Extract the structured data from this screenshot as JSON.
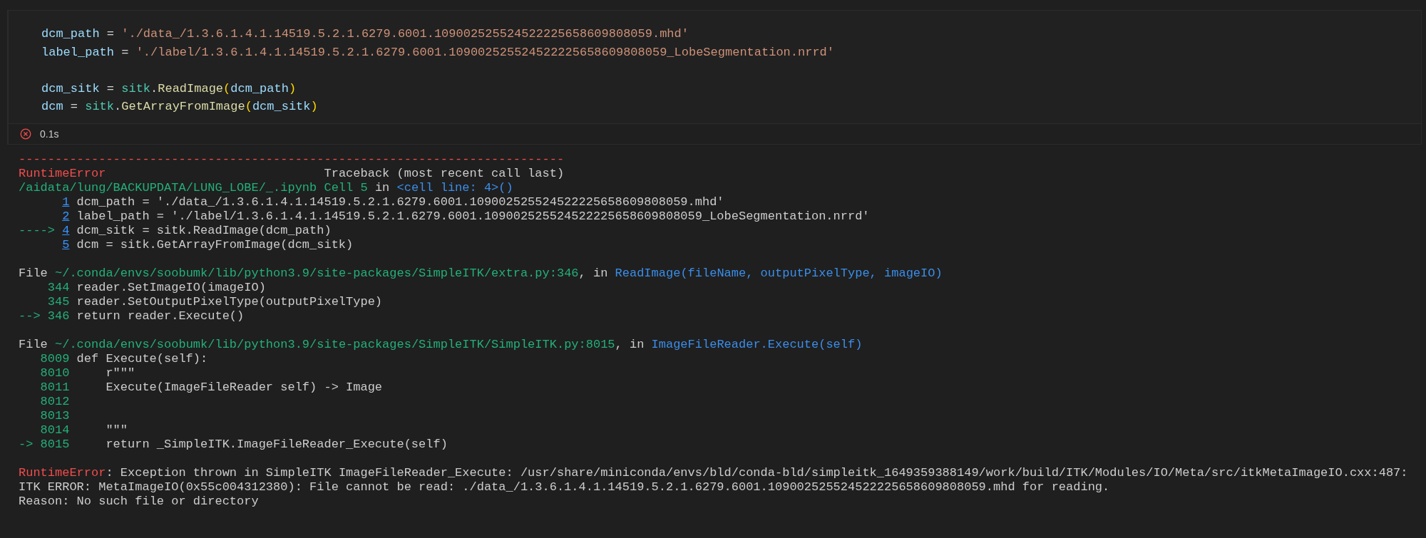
{
  "cell": {
    "code_blocks": [
      [
        [
          {
            "kind": "var",
            "text": "dcm_path"
          },
          {
            "kind": "op",
            "text": " = "
          },
          {
            "kind": "str",
            "text": "'./data_/1.3.6.1.4.1.14519.5.2.1.6279.6001.109002525524522225658609808059.mhd'"
          }
        ],
        [
          {
            "kind": "var",
            "text": "label_path"
          },
          {
            "kind": "op",
            "text": " = "
          },
          {
            "kind": "str",
            "text": "'./label/1.3.6.1.4.1.14519.5.2.1.6279.6001.109002525524522225658609808059_LobeSegmentation.nrrd'"
          }
        ]
      ],
      [
        [
          {
            "kind": "var",
            "text": "dcm_sitk"
          },
          {
            "kind": "op",
            "text": " = "
          },
          {
            "kind": "module",
            "text": "sitk"
          },
          {
            "kind": "op",
            "text": "."
          },
          {
            "kind": "func",
            "text": "ReadImage"
          },
          {
            "kind": "paren",
            "text": "("
          },
          {
            "kind": "var",
            "text": "dcm_path"
          },
          {
            "kind": "paren",
            "text": ")"
          }
        ],
        [
          {
            "kind": "var",
            "text": "dcm"
          },
          {
            "kind": "op",
            "text": " = "
          },
          {
            "kind": "module",
            "text": "sitk"
          },
          {
            "kind": "op",
            "text": "."
          },
          {
            "kind": "func",
            "text": "GetArrayFromImage"
          },
          {
            "kind": "paren",
            "text": "("
          },
          {
            "kind": "var",
            "text": "dcm_sitk"
          },
          {
            "kind": "paren",
            "text": ")"
          }
        ]
      ]
    ],
    "status": {
      "failed": true,
      "duration": "0.1s"
    }
  },
  "output": {
    "blocks": [
      [
        {
          "kind": "text",
          "segments": [
            {
              "kind": "error",
              "text": "---------------------------------------------------------------------------"
            }
          ]
        },
        {
          "kind": "text",
          "segments": [
            {
              "kind": "error",
              "text": "RuntimeError"
            },
            {
              "kind": "plain",
              "text": "                              Traceback (most recent call last)"
            }
          ]
        },
        {
          "kind": "text",
          "segments": [
            {
              "kind": "path",
              "text": "/aidata/lung/BACKUPDATA/LUNG_LOBE/_.ipynb Cell 5"
            },
            {
              "kind": "plain",
              "text": " in "
            },
            {
              "kind": "call",
              "text": "<cell line: 4>()"
            }
          ]
        },
        {
          "kind": "frame",
          "number": "1",
          "linked": true,
          "code": "dcm_path = './data_/1.3.6.1.4.1.14519.5.2.1.6279.6001.109002525524522225658609808059.mhd'"
        },
        {
          "kind": "frame",
          "number": "2",
          "linked": true,
          "code": "label_path = './label/1.3.6.1.4.1.14519.5.2.1.6279.6001.109002525524522225658609808059_LobeSegmentation.nrrd'"
        },
        {
          "kind": "frame",
          "marker": "---->",
          "number": "4",
          "linked": true,
          "code": "dcm_sitk = sitk.ReadImage(dcm_path)"
        },
        {
          "kind": "frame",
          "number": "5",
          "linked": true,
          "code": "dcm = sitk.GetArrayFromImage(dcm_sitk)"
        }
      ],
      [
        {
          "kind": "text",
          "segments": [
            {
              "kind": "plain",
              "text": "File "
            },
            {
              "kind": "path",
              "text": "~/.conda/envs/soobumk/lib/python3.9/site-packages/SimpleITK/extra.py:346"
            },
            {
              "kind": "plain",
              "text": ", in "
            },
            {
              "kind": "call",
              "text": "ReadImage(fileName, outputPixelType, imageIO)"
            }
          ]
        },
        {
          "kind": "frame",
          "number": "344",
          "linked": false,
          "code": "reader.SetImageIO(imageIO)"
        },
        {
          "kind": "frame",
          "number": "345",
          "linked": false,
          "code": "reader.SetOutputPixelType(outputPixelType)"
        },
        {
          "kind": "frame",
          "marker": "-->",
          "number": "346",
          "linked": false,
          "code": "return reader.Execute()"
        }
      ],
      [
        {
          "kind": "text",
          "segments": [
            {
              "kind": "plain",
              "text": "File "
            },
            {
              "kind": "path",
              "text": "~/.conda/envs/soobumk/lib/python3.9/site-packages/SimpleITK/SimpleITK.py:8015"
            },
            {
              "kind": "plain",
              "text": ", in "
            },
            {
              "kind": "call",
              "text": "ImageFileReader.Execute(self)"
            }
          ]
        },
        {
          "kind": "frame",
          "number": "8009",
          "linked": false,
          "code": "def Execute(self):"
        },
        {
          "kind": "frame",
          "number": "8010",
          "linked": false,
          "code": "    r\"\"\""
        },
        {
          "kind": "frame",
          "number": "8011",
          "linked": false,
          "code": "    Execute(ImageFileReader self) -> Image"
        },
        {
          "kind": "frame",
          "number": "8012",
          "linked": false
        },
        {
          "kind": "frame",
          "number": "8013",
          "linked": false
        },
        {
          "kind": "frame",
          "number": "8014",
          "linked": false,
          "code": "    \"\"\""
        },
        {
          "kind": "frame",
          "marker": "->",
          "number": "8015",
          "linked": false,
          "code": "    return _SimpleITK.ImageFileReader_Execute(self)"
        }
      ],
      [
        {
          "kind": "text",
          "segments": [
            {
              "kind": "error",
              "text": "RuntimeError"
            },
            {
              "kind": "plain",
              "text": ": Exception thrown in SimpleITK ImageFileReader_Execute: /usr/share/miniconda/envs/bld/conda-bld/simpleitk_1649359388149/work/build/ITK/Modules/IO/Meta/src/itkMetaImageIO.cxx:487:"
            }
          ]
        },
        {
          "kind": "text",
          "segments": [
            {
              "kind": "plain",
              "text": "ITK ERROR: MetaImageIO(0x55c004312380): File cannot be read: ./data_/1.3.6.1.4.1.14519.5.2.1.6279.6001.109002525524522225658609808059.mhd for reading."
            }
          ]
        },
        {
          "kind": "text",
          "segments": [
            {
              "kind": "plain",
              "text": "Reason: No such file or directory"
            }
          ]
        }
      ]
    ]
  }
}
